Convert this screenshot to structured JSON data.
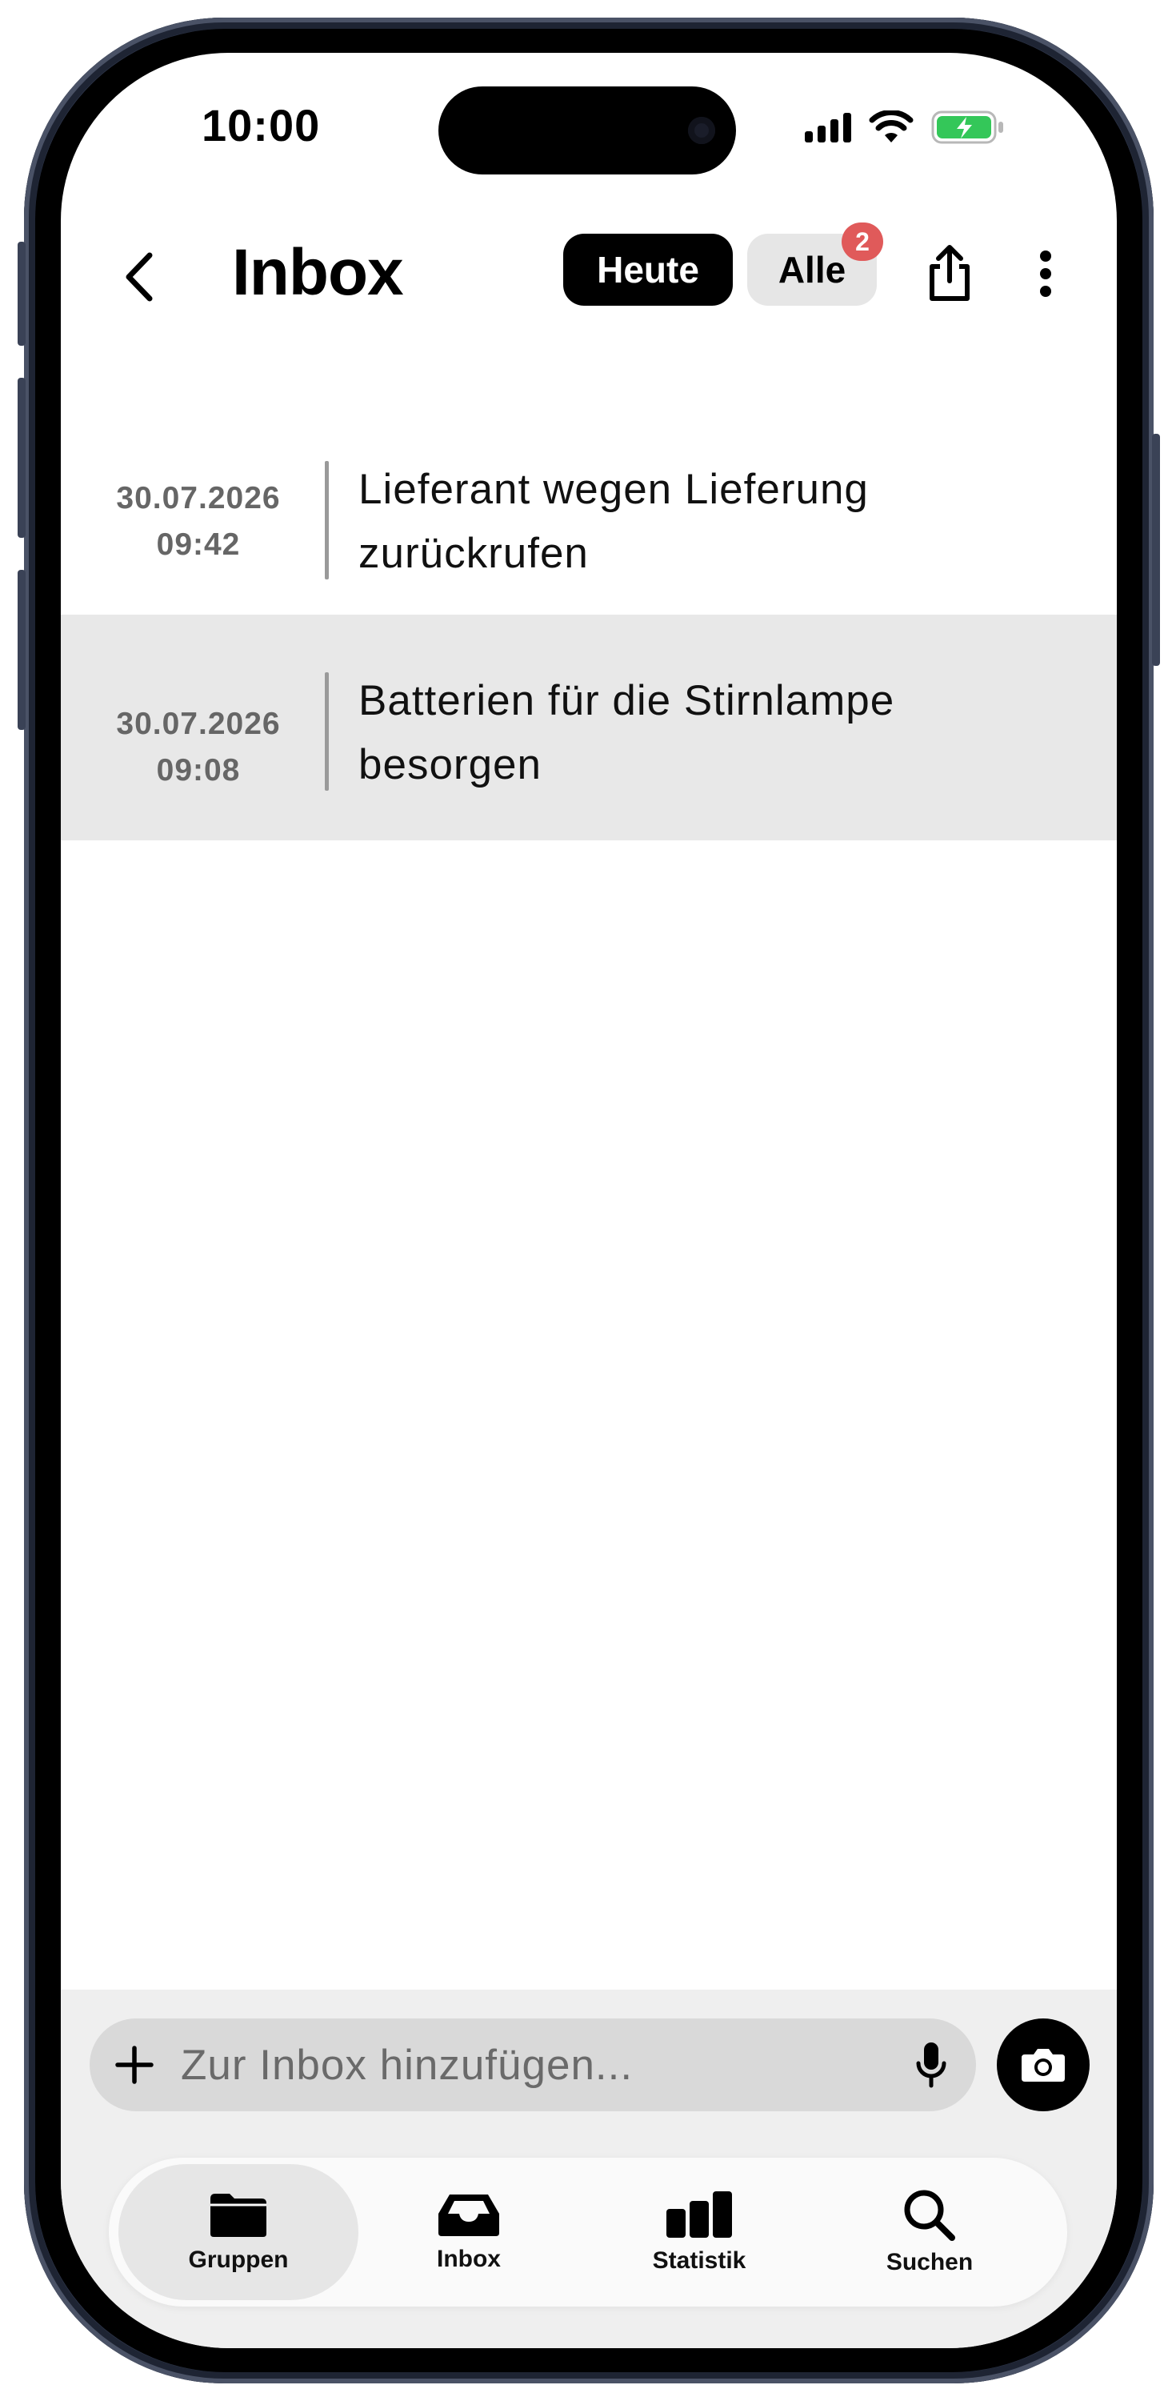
{
  "status_bar": {
    "time": "10:00",
    "icons": [
      "signal-icon",
      "wifi-icon",
      "battery-charging-icon"
    ],
    "battery_color": "#34c759"
  },
  "header": {
    "title": "Inbox",
    "filter_today": "Heute",
    "filter_all": "Alle",
    "filter_all_badge": "2",
    "badge_color": "#e05a5a",
    "icons": [
      "chevron-left-icon",
      "share-icon",
      "more-vertical-icon"
    ]
  },
  "entries": [
    {
      "date": "30.07.2026",
      "time": "09:42",
      "line1": "Lieferant wegen Lieferung",
      "line2": "zurückrufen",
      "selected": false
    },
    {
      "date": "30.07.2026",
      "time": "09:08",
      "line1": "Batterien für die Stirnlampe",
      "line2": "besorgen",
      "selected": true
    }
  ],
  "composer": {
    "placeholder": "Zur Inbox hinzufügen...",
    "icons": [
      "plus-icon",
      "microphone-icon",
      "camera-icon"
    ]
  },
  "tabbar": {
    "items": [
      {
        "label": "Gruppen",
        "icon": "folder-icon",
        "active": true
      },
      {
        "label": "Inbox",
        "icon": "inbox-tray-icon",
        "active": false
      },
      {
        "label": "Statistik",
        "icon": "bar-chart-icon",
        "active": false
      },
      {
        "label": "Suchen",
        "icon": "search-icon",
        "active": false
      }
    ]
  }
}
